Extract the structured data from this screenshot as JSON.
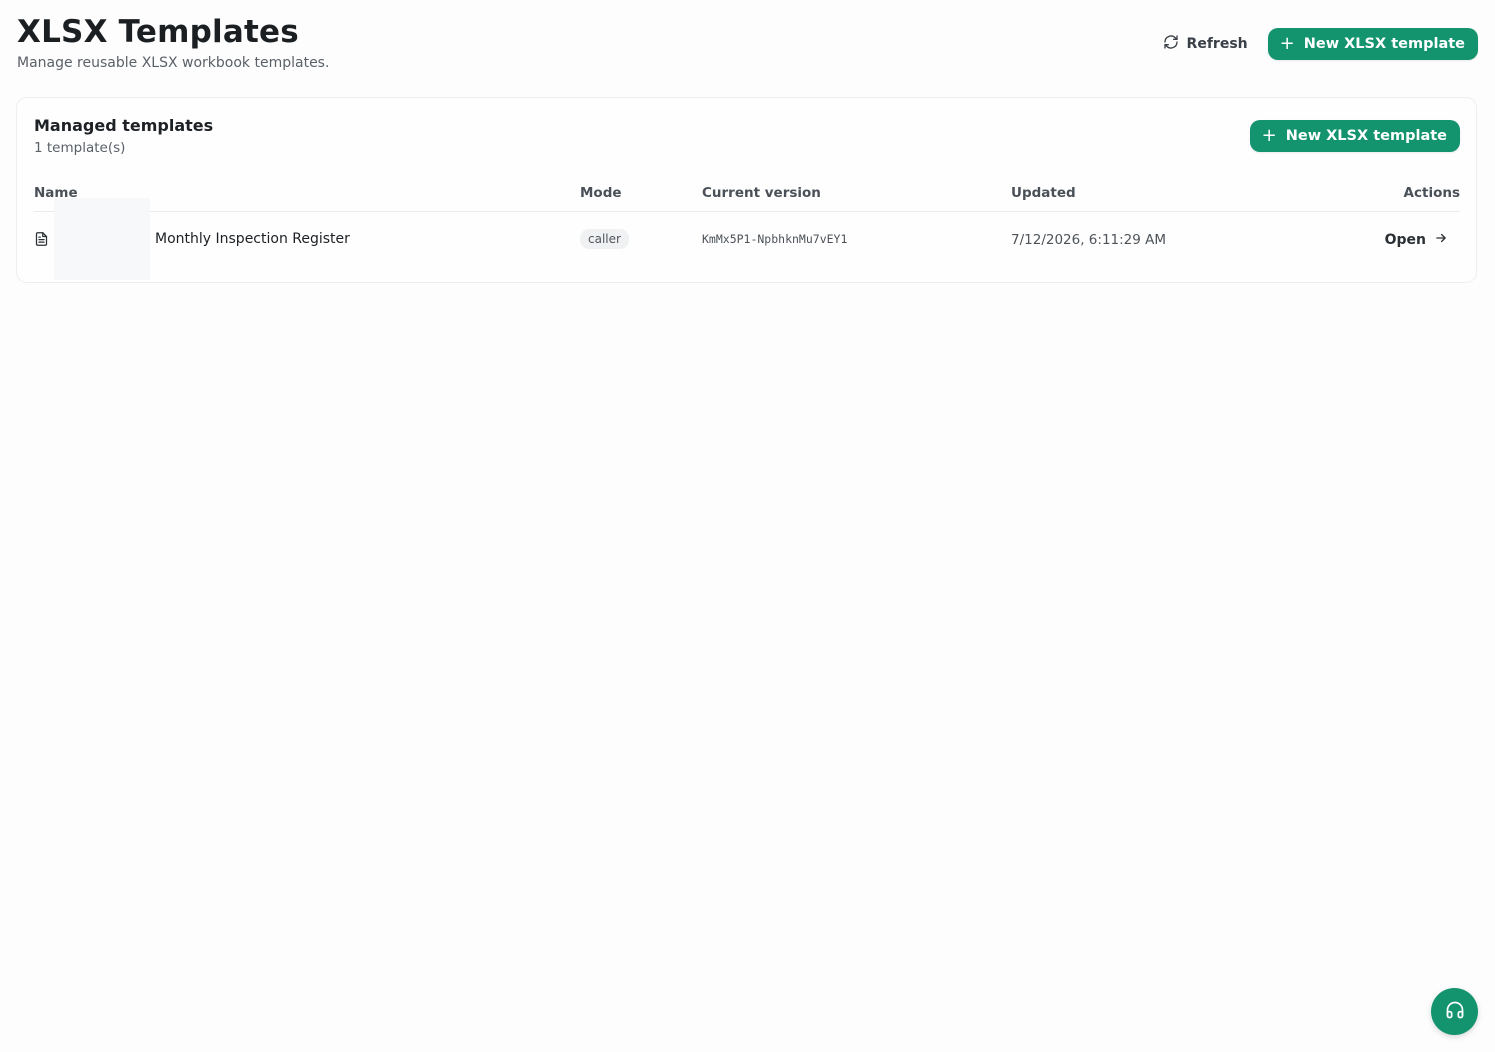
{
  "header": {
    "title": "XLSX Templates",
    "subtitle": "Manage reusable XLSX workbook templates.",
    "refresh_label": "Refresh",
    "new_template_label": "New XLSX template"
  },
  "card": {
    "title": "Managed templates",
    "count": "1 template(s)",
    "new_template_label": "New XLSX template",
    "columns": {
      "name": "Name",
      "mode": "Mode",
      "version": "Current version",
      "updated": "Updated",
      "actions": "Actions"
    },
    "rows": [
      {
        "icon": "file-text-icon",
        "name": "Monthly Inspection Register",
        "mode": "caller",
        "version": "KmMx5P1-NpbhknMu7vEY1",
        "updated": "7/12/2026, 6:11:29 AM",
        "action": "Open"
      }
    ]
  },
  "support": {
    "icon": "headphones-icon"
  },
  "colors": {
    "accent": "#13946f",
    "background": "#fdfdfd",
    "border": "#eceeef"
  }
}
